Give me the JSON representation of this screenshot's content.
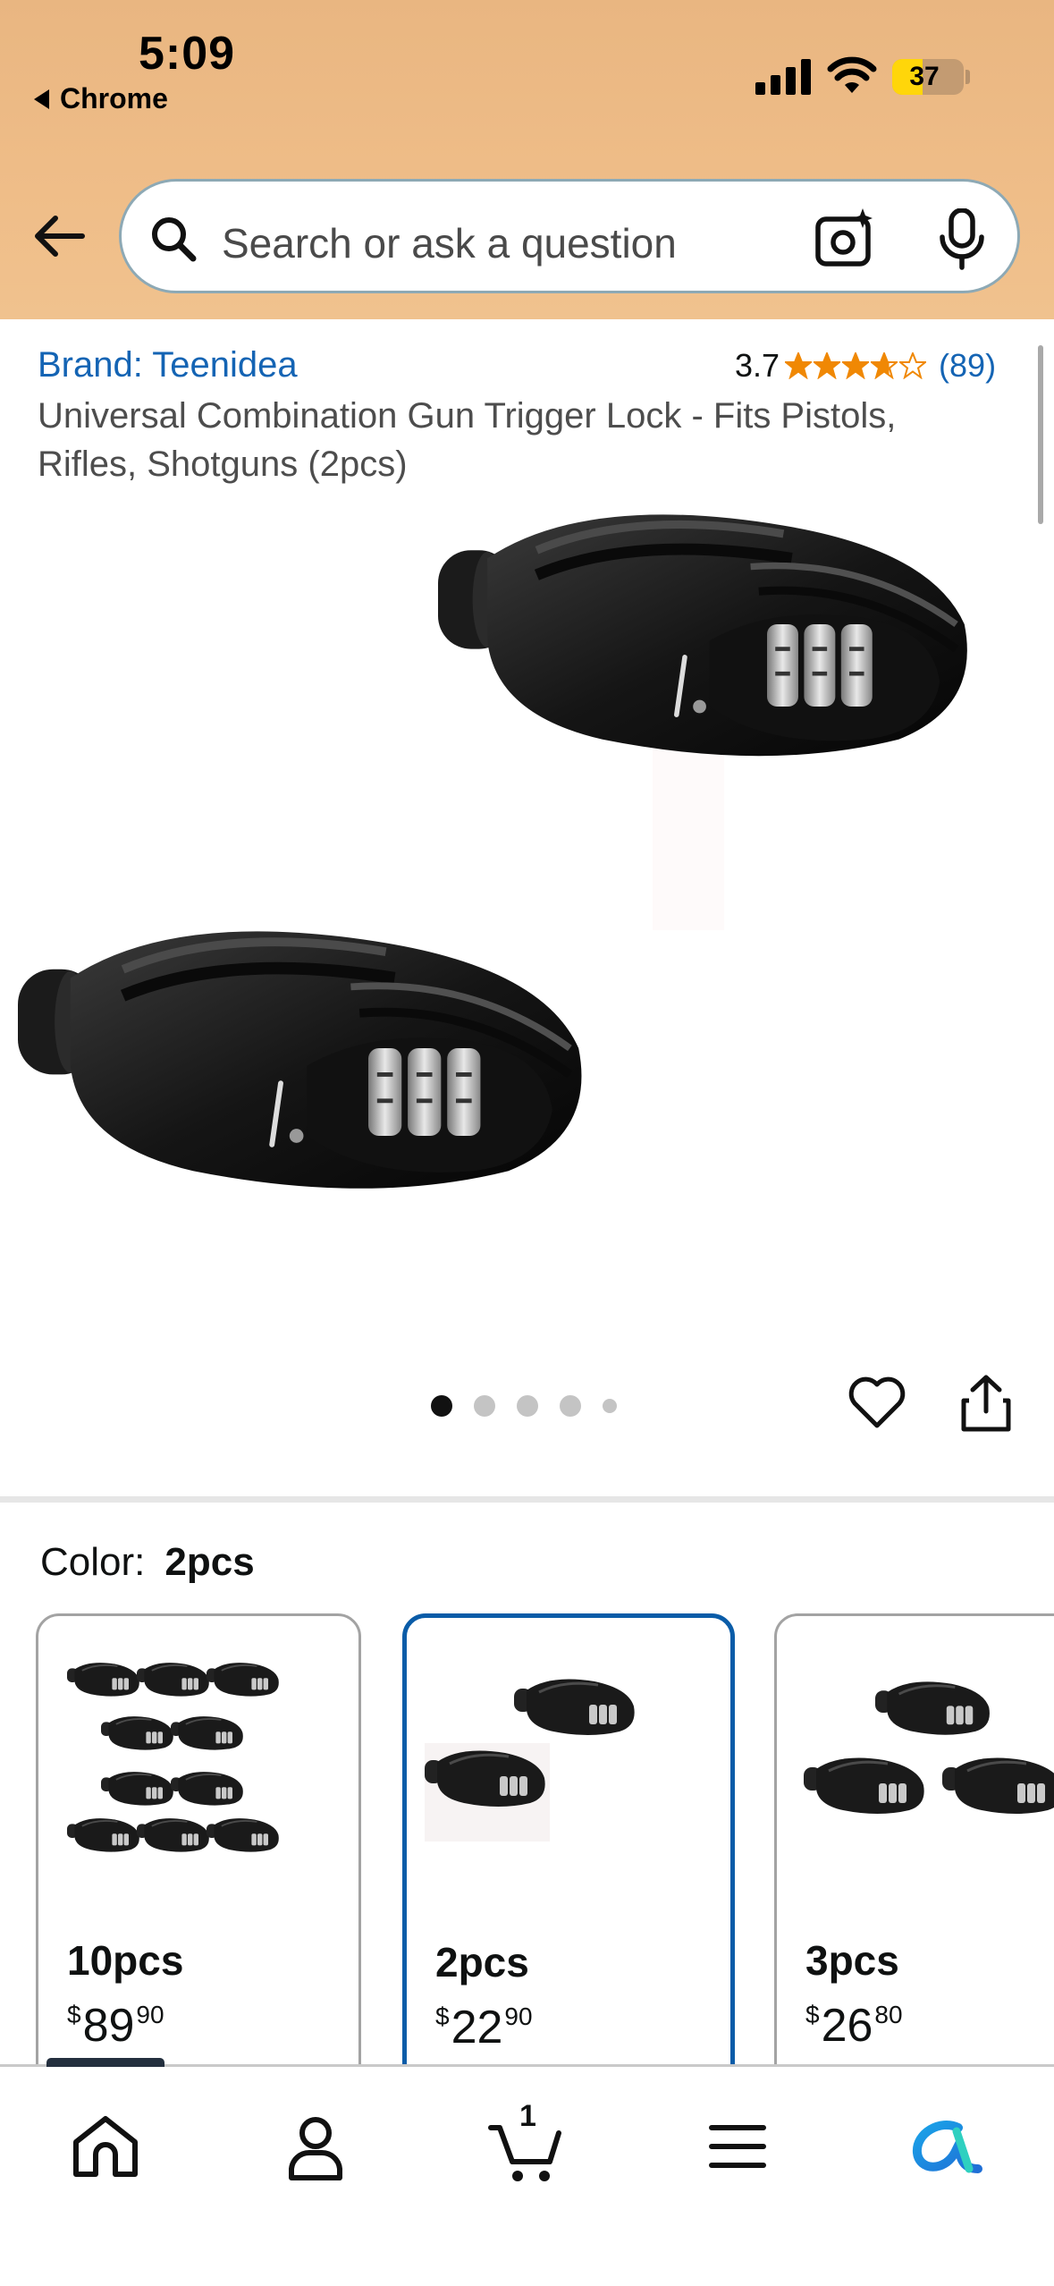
{
  "status_bar": {
    "time": "5:09",
    "back_app": "Chrome",
    "battery": "37",
    "battery_level": 0.37
  },
  "search": {
    "placeholder": "Search or ask a question"
  },
  "product": {
    "brand": "Brand: Teenidea",
    "rating": "3.7",
    "rating_stars": 3.7,
    "rating_count": "(89)",
    "title": "Universal Combination Gun Trigger Lock - Fits Pistols, Rifles, Shotguns (2pcs)",
    "image_count": 5,
    "current_image": 1
  },
  "color": {
    "label": "Color:",
    "selected": "2pcs"
  },
  "variants": [
    {
      "name": "10pcs",
      "currency": "$",
      "dollars": "89",
      "cents": "90"
    },
    {
      "name": "2pcs",
      "currency": "$",
      "dollars": "22",
      "cents": "90"
    },
    {
      "name": "3pcs",
      "currency": "$",
      "dollars": "26",
      "cents": "80"
    }
  ],
  "bottom_nav": {
    "cart_count": "1",
    "items": [
      "home-icon",
      "account-icon",
      "cart-icon",
      "menu-icon",
      "rufus-icon"
    ]
  },
  "colors": {
    "header": "#efbd88",
    "link": "#1464b4",
    "star": "#f08804",
    "selected_border": "#0a5ca8"
  }
}
